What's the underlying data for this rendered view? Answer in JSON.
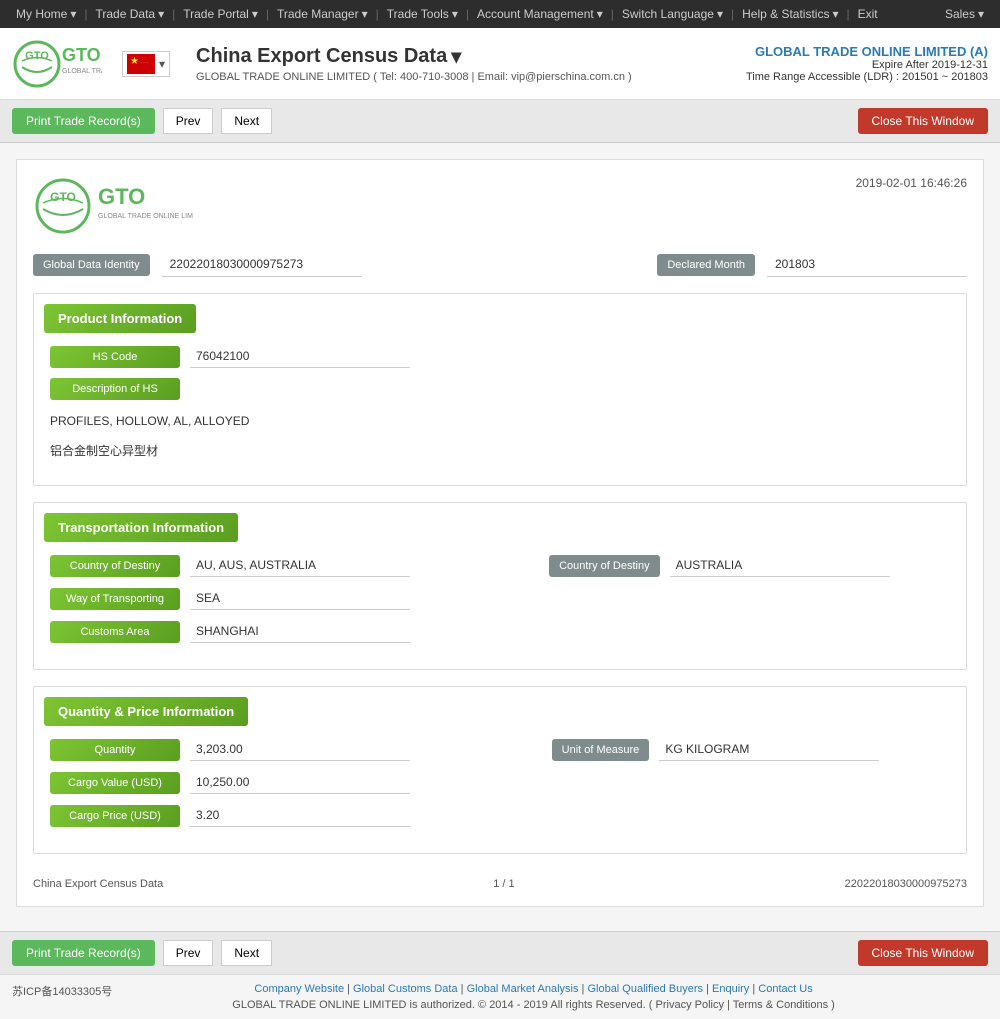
{
  "topNav": {
    "items": [
      {
        "label": "My Home",
        "hasDropdown": true
      },
      {
        "label": "Trade Data",
        "hasDropdown": true
      },
      {
        "label": "Trade Portal",
        "hasDropdown": true
      },
      {
        "label": "Trade Manager",
        "hasDropdown": true
      },
      {
        "label": "Trade Tools",
        "hasDropdown": true
      },
      {
        "label": "Account Management",
        "hasDropdown": true
      },
      {
        "label": "Switch Language",
        "hasDropdown": true
      },
      {
        "label": "Help & Statistics",
        "hasDropdown": true
      },
      {
        "label": "Exit",
        "hasDropdown": false
      }
    ],
    "rightLabel": "Sales"
  },
  "header": {
    "title": "China Export Census Data",
    "subtitle": "GLOBAL TRADE ONLINE LIMITED ( Tel: 400-710-3008 | Email: vip@pierschina.com.cn )",
    "companyName": "GLOBAL TRADE ONLINE LIMITED (A)",
    "expireDate": "Expire After 2019-12-31",
    "dateRange": "Time Range Accessible (LDR) : 201501 ~ 201803"
  },
  "toolbar": {
    "printLabel": "Print Trade Record(s)",
    "prevLabel": "Prev",
    "nextLabel": "Next",
    "closeLabel": "Close This Window"
  },
  "record": {
    "timestamp": "2019-02-01 16:46:26",
    "globalDataIdentityLabel": "Global Data Identity",
    "globalDataIdentityValue": "22022018030000975273",
    "declaredMonthLabel": "Declared Month",
    "declaredMonthValue": "201803",
    "sections": {
      "productInfo": {
        "title": "Product Information",
        "hsCodeLabel": "HS Code",
        "hsCodeValue": "76042100",
        "descriptionLabel": "Description of HS",
        "descriptionValue1": "PROFILES, HOLLOW, AL, ALLOYED",
        "descriptionValue2": "铝合金制空心异型材"
      },
      "transportInfo": {
        "title": "Transportation Information",
        "countryOfDestinyLabel": "Country of Destiny",
        "countryOfDestinyValue": "AU, AUS, AUSTRALIA",
        "countryOfDestiny2Label": "Country of Destiny",
        "countryOfDestiny2Value": "AUSTRALIA",
        "wayOfTransportingLabel": "Way of Transporting",
        "wayOfTransportingValue": "SEA",
        "customsAreaLabel": "Customs Area",
        "customsAreaValue": "SHANGHAI"
      },
      "quantityInfo": {
        "title": "Quantity & Price Information",
        "quantityLabel": "Quantity",
        "quantityValue": "3,203.00",
        "unitOfMeasureLabel": "Unit of Measure",
        "unitOfMeasureValue": "KG KILOGRAM",
        "cargoValueLabel": "Cargo Value (USD)",
        "cargoValueValue": "10,250.00",
        "cargoPriceLabel": "Cargo Price (USD)",
        "cargoPriceValue": "3.20"
      }
    },
    "footer": {
      "leftText": "China Export Census Data",
      "centerText": "1 / 1",
      "rightText": "22022018030000975273"
    }
  },
  "footer": {
    "icp": "苏ICP备14033305号",
    "links": [
      "Company Website",
      "Global Customs Data",
      "Global Market Analysis",
      "Global Qualified Buyers",
      "Enquiry",
      "Contact Us"
    ],
    "copyright": "GLOBAL TRADE ONLINE LIMITED is authorized. © 2014 - 2019 All rights Reserved.  (  Privacy Policy | Terms & Conditions  )"
  }
}
